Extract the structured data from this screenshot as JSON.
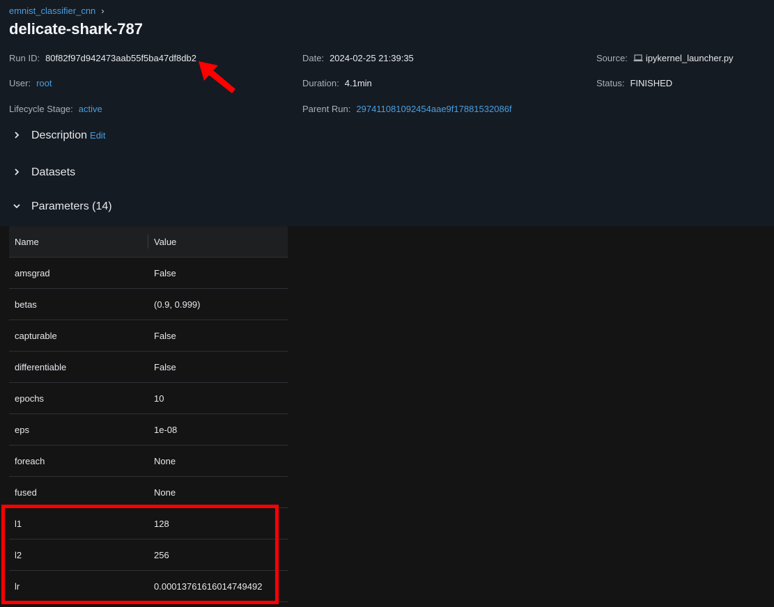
{
  "breadcrumb": {
    "experiment": "emnist_classifier_cnn",
    "separator": "›"
  },
  "run": {
    "title": "delicate-shark-787"
  },
  "meta": {
    "run_id_label": "Run ID:",
    "run_id": "80f82f97d942473aab55f5ba47df8db2",
    "date_label": "Date:",
    "date": "2024-02-25 21:39:35",
    "source_label": "Source:",
    "source": "ipykernel_launcher.py",
    "source_icon": "laptop-icon",
    "user_label": "User:",
    "user": "root",
    "duration_label": "Duration:",
    "duration": "4.1min",
    "status_label": "Status:",
    "status": "FINISHED",
    "lifecycle_label": "Lifecycle Stage:",
    "lifecycle": "active",
    "parent_label": "Parent Run:",
    "parent": "297411081092454aae9f17881532086f"
  },
  "sections": {
    "description": "Description",
    "edit": "Edit",
    "datasets": "Datasets",
    "parameters": "Parameters (14)"
  },
  "params": {
    "columns": [
      "Name",
      "Value"
    ],
    "rows": [
      {
        "name": "amsgrad",
        "value": "False"
      },
      {
        "name": "betas",
        "value": "(0.9, 0.999)"
      },
      {
        "name": "capturable",
        "value": "False"
      },
      {
        "name": "differentiable",
        "value": "False"
      },
      {
        "name": "epochs",
        "value": "10"
      },
      {
        "name": "eps",
        "value": "1e-08"
      },
      {
        "name": "foreach",
        "value": "None"
      },
      {
        "name": "fused",
        "value": "None"
      },
      {
        "name": "l1",
        "value": "128"
      },
      {
        "name": "l2",
        "value": "256"
      },
      {
        "name": "lr",
        "value": "0.00013761616014749492"
      }
    ]
  },
  "colors": {
    "accent_link": "#4a9fe0",
    "annotation": "#ff0000",
    "background": "#151b23"
  }
}
